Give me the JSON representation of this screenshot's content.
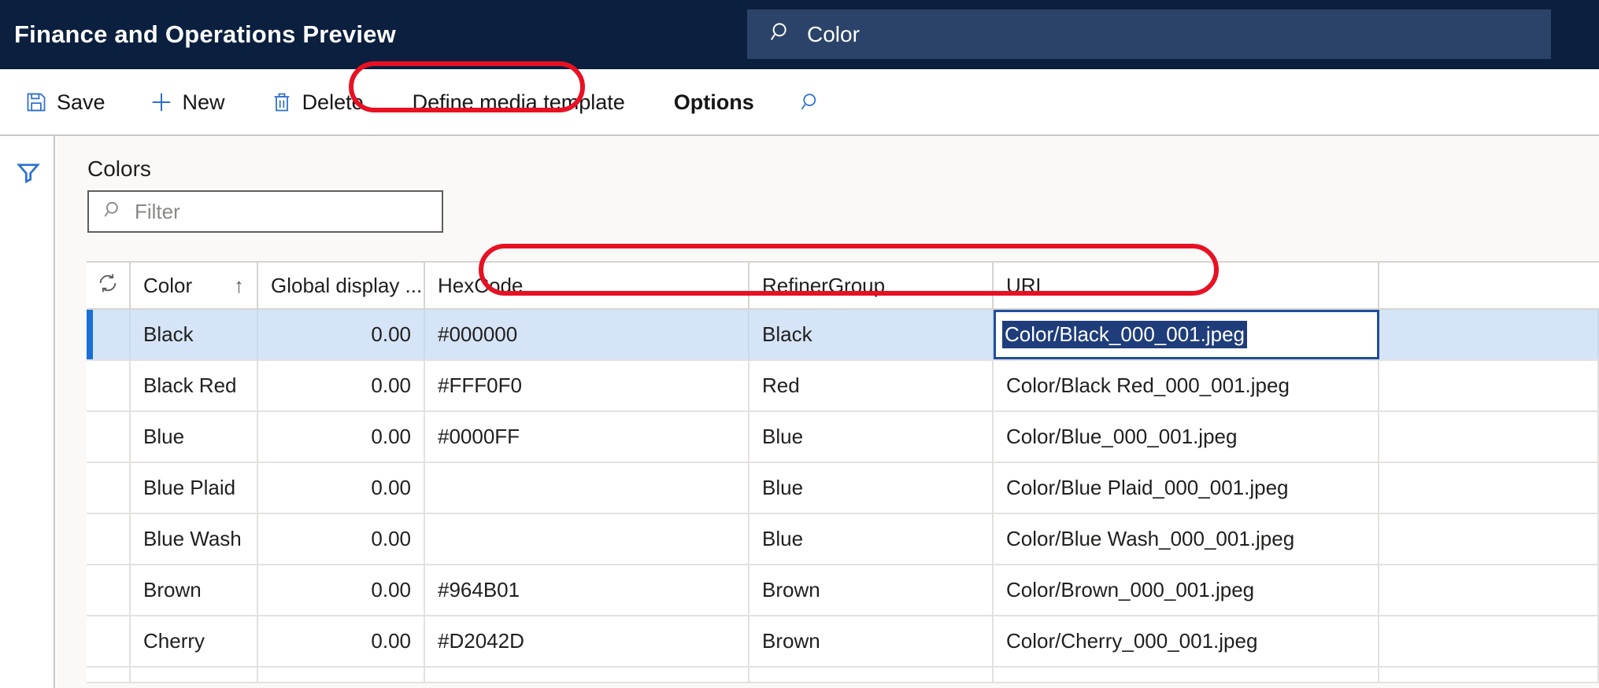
{
  "topbar": {
    "app_title": "Finance and Operations Preview",
    "search": {
      "icon": "search-icon",
      "value": "Color"
    }
  },
  "actionbar": {
    "items": [
      {
        "id": "save",
        "label": "Save",
        "icon": "save-icon"
      },
      {
        "id": "new",
        "label": "New",
        "icon": "plus-icon"
      },
      {
        "id": "delete",
        "label": "Delete",
        "icon": "trash-icon"
      },
      {
        "id": "define",
        "label": "Define media template",
        "icon": ""
      },
      {
        "id": "options",
        "label": "Options",
        "icon": ""
      },
      {
        "id": "find",
        "label": "",
        "icon": "search-icon"
      }
    ]
  },
  "left_rail": {
    "filter_icon": "funnel-icon"
  },
  "content": {
    "heading": "Colors",
    "filter": {
      "icon": "search-icon",
      "placeholder": "Filter",
      "value": ""
    }
  },
  "grid": {
    "refresh_icon": "refresh-icon",
    "sort_indicator": "↑",
    "columns": [
      {
        "key": "color",
        "label": "Color"
      },
      {
        "key": "global",
        "label": "Global display ..."
      },
      {
        "key": "hex",
        "label": "HexCode"
      },
      {
        "key": "refiner",
        "label": "RefinerGroup"
      },
      {
        "key": "url",
        "label": "URL"
      }
    ],
    "rows": [
      {
        "color": "Black",
        "global": "0.00",
        "hex": "#000000",
        "refiner": "Black",
        "url": "Color/Black_000_001.jpeg",
        "selected": true,
        "editing": true
      },
      {
        "color": "Black Red",
        "global": "0.00",
        "hex": "#FFF0F0",
        "refiner": "Red",
        "url": "Color/Black Red_000_001.jpeg",
        "selected": false,
        "editing": false
      },
      {
        "color": "Blue",
        "global": "0.00",
        "hex": "#0000FF",
        "refiner": "Blue",
        "url": "Color/Blue_000_001.jpeg",
        "selected": false,
        "editing": false
      },
      {
        "color": "Blue Plaid",
        "global": "0.00",
        "hex": "",
        "refiner": "Blue",
        "url": "Color/Blue Plaid_000_001.jpeg",
        "selected": false,
        "editing": false
      },
      {
        "color": "Blue Wash",
        "global": "0.00",
        "hex": "",
        "refiner": "Blue",
        "url": "Color/Blue Wash_000_001.jpeg",
        "selected": false,
        "editing": false
      },
      {
        "color": "Brown",
        "global": "0.00",
        "hex": "#964B01",
        "refiner": "Brown",
        "url": "Color/Brown_000_001.jpeg",
        "selected": false,
        "editing": false
      },
      {
        "color": "Cherry",
        "global": "0.00",
        "hex": "#D2042D",
        "refiner": "Brown",
        "url": "Color/Cherry_000_001.jpeg",
        "selected": false,
        "editing": false
      }
    ]
  },
  "annotations": {
    "color": "#E81123",
    "shapes": [
      {
        "id": "define-media-template-highlight",
        "target": "Define media template"
      },
      {
        "id": "grid-columns-highlight",
        "target": "HexCode / RefinerGroup / URL"
      }
    ]
  },
  "theme": {
    "topbar_bg": "#0B1F3F",
    "search_bg": "#2B4368",
    "accent_blue": "#1A6FD4",
    "selection_bg": "#D6E4F7",
    "content_bg": "#FAF9F8"
  }
}
